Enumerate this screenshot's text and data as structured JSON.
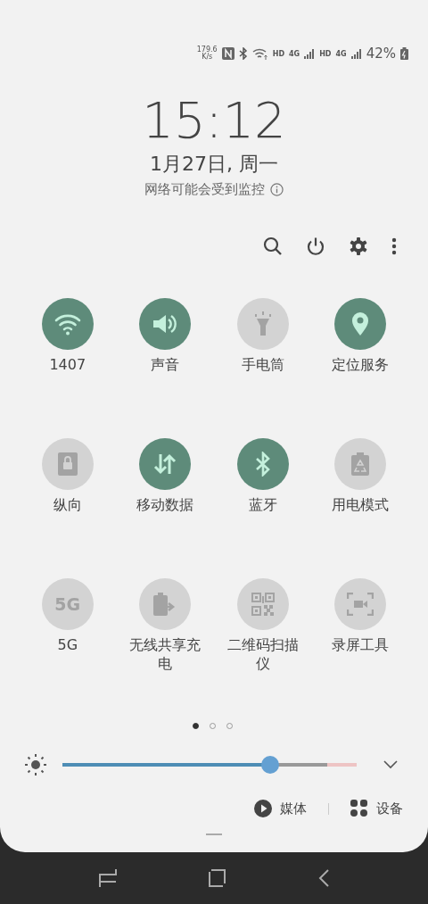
{
  "status_bar": {
    "speed": [
      "179.6",
      "K/s"
    ],
    "sim1": {
      "hd": "HD",
      "network": "4G"
    },
    "sim2": {
      "hd": "HD",
      "network": "4G"
    },
    "battery": "42%"
  },
  "clock": {
    "time": "15:12",
    "date": "1月27日, 周一",
    "notice": "网络可能会受到监控"
  },
  "tiles": [
    {
      "kind": "wifi",
      "label": "1407",
      "on": true
    },
    {
      "kind": "sound",
      "label": "声音",
      "on": true
    },
    {
      "kind": "flashlight",
      "label": "手电筒",
      "on": false
    },
    {
      "kind": "location",
      "label": "定位服务",
      "on": true
    },
    {
      "kind": "orientation",
      "label": "纵向",
      "on": false
    },
    {
      "kind": "data",
      "label": "移动数据",
      "on": true
    },
    {
      "kind": "bluetooth",
      "label": "蓝牙",
      "on": true
    },
    {
      "kind": "power",
      "label": "用电模式",
      "on": false
    },
    {
      "kind": "fiveg",
      "label": "5G",
      "icon_text": "5G",
      "on": false
    },
    {
      "kind": "share",
      "label": "无线共享充电",
      "on": false
    },
    {
      "kind": "qr",
      "label": "二维码扫描仪",
      "on": false
    },
    {
      "kind": "record",
      "label": "录屏工具",
      "on": false
    }
  ],
  "pages": [
    {
      "selected": true
    },
    {
      "selected": false
    },
    {
      "selected": false
    }
  ],
  "brightness": {
    "level": 0.706
  },
  "output": {
    "media": "媒体",
    "devices": "设备"
  }
}
